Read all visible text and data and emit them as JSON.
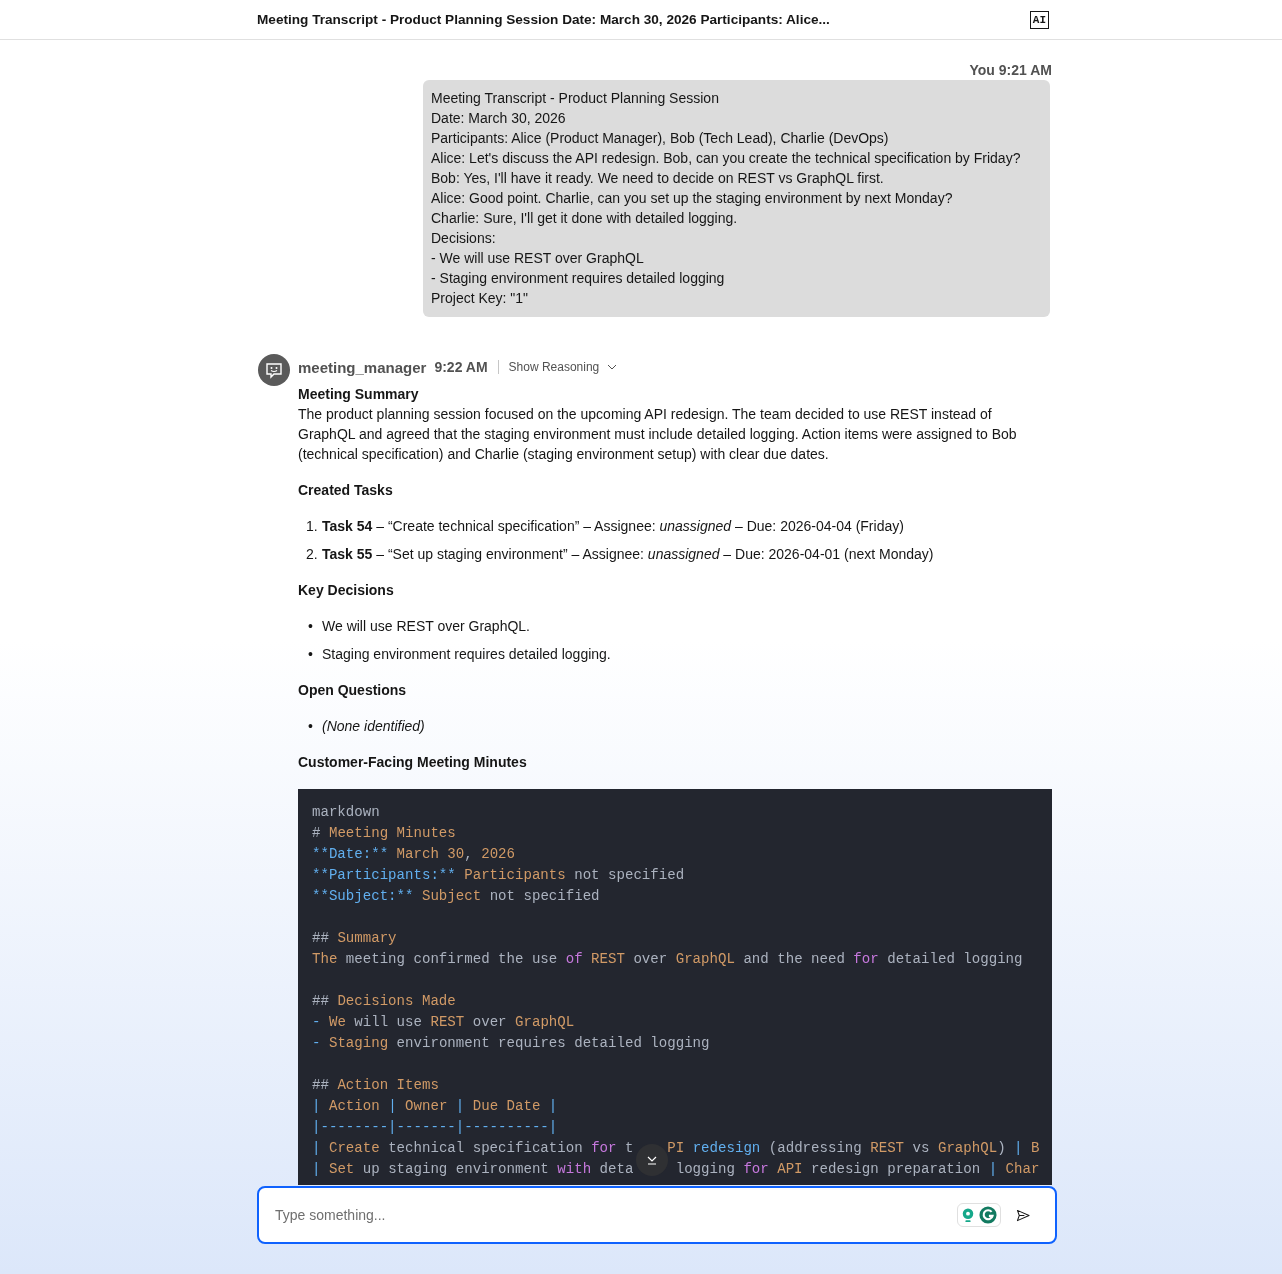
{
  "header": {
    "title": "Meeting Transcript - Product Planning Session Date: March 30, 2026 Participants: Alice...",
    "badge": "AI"
  },
  "user_message": {
    "sender": "You",
    "time": "9:21 AM",
    "lines": [
      "Meeting Transcript - Product Planning Session",
      "Date: March 30, 2026",
      "Participants: Alice (Product Manager), Bob (Tech Lead), Charlie (DevOps)",
      "Alice: Let's discuss the API redesign. Bob, can you create the technical specification by Friday?",
      "Bob: Yes, I'll have it ready. We need to decide on REST vs GraphQL first.",
      "Alice: Good point. Charlie, can you set up the staging environment by next Monday?",
      "Charlie: Sure, I'll get it done with detailed logging.",
      "Decisions:",
      "- We will use REST over GraphQL",
      "- Staging environment requires detailed logging",
      "Project Key: \"1\""
    ]
  },
  "bot_message": {
    "sender": "meeting_manager",
    "time": "9:22 AM",
    "reasoning_toggle": "Show Reasoning",
    "expanded": false,
    "sections": [
      {
        "kind": "paragraph",
        "heading": "Meeting Summary",
        "text": "The product planning session focused on the upcoming API redesign. The team decided to use REST instead of GraphQL and agreed that the staging environment must include detailed logging. Action items were assigned to Bob (technical specification) and Charlie (staging environment setup) with clear due dates."
      },
      {
        "kind": "ordered",
        "heading": "Created Tasks",
        "items": [
          {
            "marker": "1.",
            "text": "**Task 54** – “Create technical specification” – Assignee: *unassigned* – Due: 2026-04-04 (Friday)",
            "italic": false
          },
          {
            "marker": "2.",
            "text": "**Task 55** – “Set up staging environment” – Assignee: *unassigned* – Due: 2026-04-01 (next Monday)",
            "italic": false
          }
        ]
      },
      {
        "kind": "bullets",
        "heading": "Key Decisions",
        "items": [
          {
            "marker": "•",
            "text": "We will use REST over GraphQL.",
            "italic": false
          },
          {
            "marker": "•",
            "text": "Staging environment requires detailed logging.",
            "italic": false
          }
        ]
      },
      {
        "kind": "bullets",
        "heading": "Open Questions",
        "items": [
          {
            "marker": "•",
            "text": "(None identified)",
            "italic": true
          }
        ]
      },
      {
        "kind": "code",
        "heading": "Customer-Facing Meeting Minutes",
        "blocks": [
          [
            [
              {
                "kind": "plain",
                "text": "markdown"
              }
            ],
            [
              {
                "kind": "plain",
                "text": "# "
              },
              {
                "kind": "name",
                "text": "Meeting Minutes"
              }
            ],
            [
              {
                "kind": "marker",
                "text": "**Date:**"
              },
              {
                "kind": "name",
                "text": " March 30"
              },
              {
                "kind": "plain",
                "text": ", "
              },
              {
                "kind": "name",
                "text": "2026"
              }
            ],
            [
              {
                "kind": "marker",
                "text": "**Participants:**"
              },
              {
                "kind": "name",
                "text": " Participants"
              },
              {
                "kind": "plain",
                "text": " not specified"
              }
            ],
            [
              {
                "kind": "marker",
                "text": "**Subject:**"
              },
              {
                "kind": "name",
                "text": " Subject"
              },
              {
                "kind": "plain",
                "text": " not specified"
              }
            ]
          ],
          [
            [
              {
                "kind": "plain",
                "text": "## "
              },
              {
                "kind": "name",
                "text": "Summary"
              }
            ],
            [
              {
                "kind": "name",
                "text": "The"
              },
              {
                "kind": "plain",
                "text": " meeting confirmed the use "
              },
              {
                "kind": "keyword",
                "text": "of"
              },
              {
                "kind": "name",
                "text": " REST"
              },
              {
                "kind": "plain",
                "text": " over "
              },
              {
                "kind": "name",
                "text": "GraphQL"
              },
              {
                "kind": "plain",
                "text": " and the need "
              },
              {
                "kind": "keyword",
                "text": "for"
              },
              {
                "kind": "plain",
                "text": " detailed logging"
              }
            ]
          ],
          [
            [
              {
                "kind": "plain",
                "text": "## "
              },
              {
                "kind": "name",
                "text": "Decisions Made"
              }
            ],
            [
              {
                "kind": "marker",
                "text": "- "
              },
              {
                "kind": "name",
                "text": "We"
              },
              {
                "kind": "plain",
                "text": " will use "
              },
              {
                "kind": "name",
                "text": "REST"
              },
              {
                "kind": "plain",
                "text": " over "
              },
              {
                "kind": "name",
                "text": "GraphQL"
              }
            ],
            [
              {
                "kind": "marker",
                "text": "- "
              },
              {
                "kind": "name",
                "text": "Staging"
              },
              {
                "kind": "plain",
                "text": " environment requires detailed logging"
              }
            ]
          ],
          [
            [
              {
                "kind": "plain",
                "text": "## "
              },
              {
                "kind": "name",
                "text": "Action Items"
              }
            ],
            [
              {
                "kind": "marker",
                "text": "| "
              },
              {
                "kind": "name",
                "text": "Action"
              },
              {
                "kind": "marker",
                "text": " | "
              },
              {
                "kind": "name",
                "text": "Owner"
              },
              {
                "kind": "marker",
                "text": " | "
              },
              {
                "kind": "name",
                "text": "Due Date"
              },
              {
                "kind": "marker",
                "text": " |"
              }
            ],
            [
              {
                "kind": "marker",
                "text": "|--------|-------|----------|"
              }
            ],
            [
              {
                "kind": "marker",
                "text": "| "
              },
              {
                "kind": "name",
                "text": "Create"
              },
              {
                "kind": "plain",
                "text": " technical specification "
              },
              {
                "kind": "keyword",
                "text": "for"
              },
              {
                "kind": "plain",
                "text": " t"
              },
              {
                "kind": "gap"
              },
              {
                "kind": "name",
                "text": "PI"
              },
              {
                "kind": "marker",
                "text": " redesign"
              },
              {
                "kind": "plain",
                "text": " (addressing "
              },
              {
                "kind": "name",
                "text": "REST"
              },
              {
                "kind": "plain",
                "text": " vs "
              },
              {
                "kind": "name",
                "text": "GraphQL"
              },
              {
                "kind": "plain",
                "text": ") "
              },
              {
                "kind": "marker",
                "text": "| "
              },
              {
                "kind": "name",
                "text": "B"
              }
            ],
            [
              {
                "kind": "marker",
                "text": "| "
              },
              {
                "kind": "name",
                "text": "Set"
              },
              {
                "kind": "plain",
                "text": " up staging environment "
              },
              {
                "kind": "keyword",
                "text": "with"
              },
              {
                "kind": "plain",
                "text": " deta"
              },
              {
                "kind": "gap"
              },
              {
                "kind": "plain",
                "text": " logging "
              },
              {
                "kind": "keyword",
                "text": "for"
              },
              {
                "kind": "name",
                "text": " API"
              },
              {
                "kind": "plain",
                "text": " redesign preparation "
              },
              {
                "kind": "marker",
                "text": "| "
              },
              {
                "kind": "name",
                "text": "Char"
              }
            ]
          ]
        ]
      }
    ]
  },
  "composer": {
    "placeholder": "Type something..."
  }
}
